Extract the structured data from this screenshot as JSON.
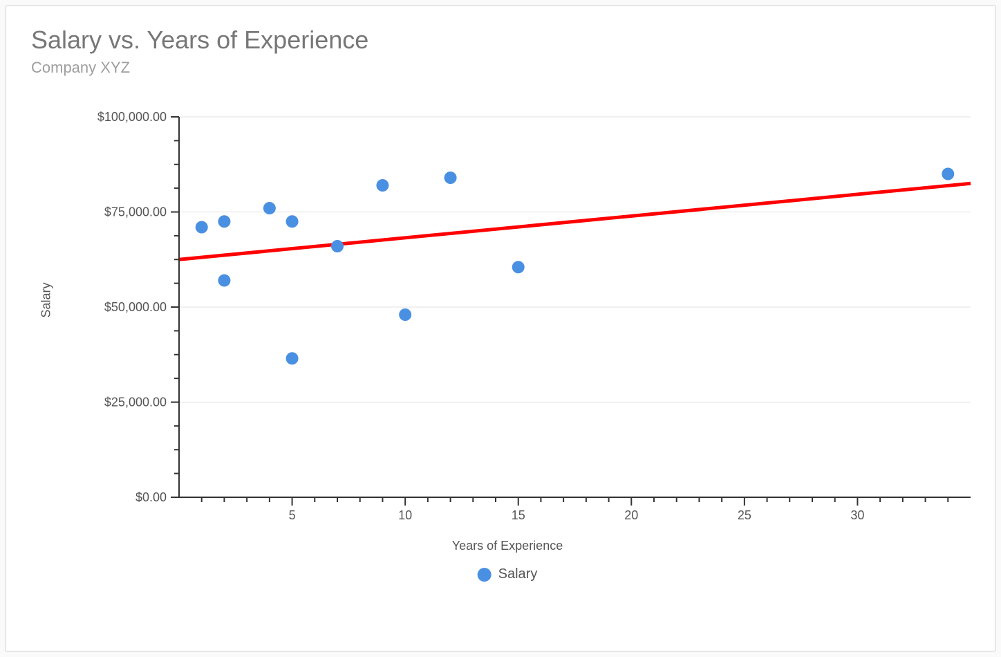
{
  "chart_data": {
    "type": "scatter",
    "title": "Salary vs. Years of Experience",
    "subtitle": "Company XYZ",
    "xlabel": "Years of Experience",
    "ylabel": "Salary",
    "legend_label": "Salary",
    "xlim": [
      0,
      35
    ],
    "ylim": [
      0,
      100000
    ],
    "x_ticks": [
      5,
      10,
      15,
      20,
      25,
      30
    ],
    "y_ticks": [
      {
        "value": 0,
        "label": "$0.00"
      },
      {
        "value": 25000,
        "label": "$25,000.00"
      },
      {
        "value": 50000,
        "label": "$50,000.00"
      },
      {
        "value": 75000,
        "label": "$75,000.00"
      },
      {
        "value": 100000,
        "label": "$100,000.00"
      }
    ],
    "series": [
      {
        "name": "Salary",
        "points": [
          {
            "x": 1,
            "y": 71000
          },
          {
            "x": 2,
            "y": 72500
          },
          {
            "x": 2,
            "y": 57000
          },
          {
            "x": 4,
            "y": 76000
          },
          {
            "x": 5,
            "y": 72500
          },
          {
            "x": 5,
            "y": 36500
          },
          {
            "x": 7,
            "y": 66000
          },
          {
            "x": 9,
            "y": 82000
          },
          {
            "x": 10,
            "y": 48000
          },
          {
            "x": 12,
            "y": 84000
          },
          {
            "x": 15,
            "y": 60500
          },
          {
            "x": 34,
            "y": 85000
          }
        ]
      }
    ],
    "trendline": {
      "start": {
        "x": 0,
        "y": 62500
      },
      "end": {
        "x": 35,
        "y": 82500
      }
    },
    "colors": {
      "point": "#4a90e2",
      "trend": "#ff0000",
      "grid": "#e0e0e0",
      "axis": "#333333"
    }
  }
}
